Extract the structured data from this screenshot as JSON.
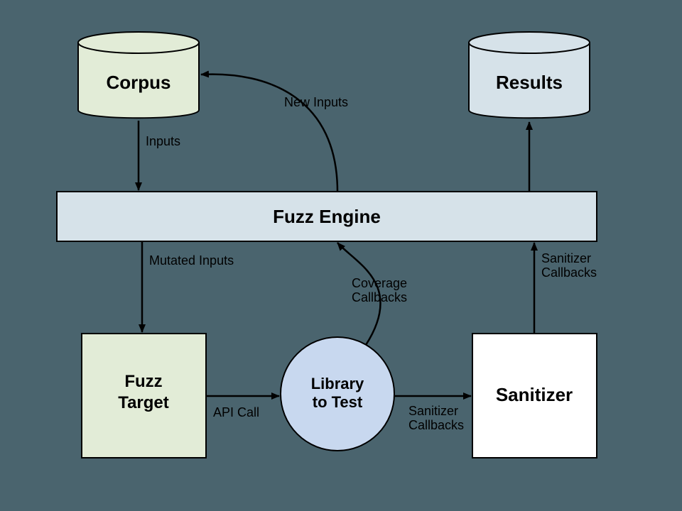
{
  "nodes": {
    "corpus": {
      "label": "Corpus"
    },
    "results": {
      "label": "Results"
    },
    "fuzz_engine": {
      "label": "Fuzz Engine"
    },
    "fuzz_target": {
      "line1": "Fuzz",
      "line2": "Target"
    },
    "library": {
      "line1": "Library",
      "line2": "to Test"
    },
    "sanitizer": {
      "label": "Sanitizer"
    }
  },
  "edges": {
    "inputs": "Inputs",
    "new_inputs": "New Inputs",
    "mutated_inputs": "Mutated Inputs",
    "api_call": "API Call",
    "sanitizer_callbacks_lower": "Sanitizer",
    "sanitizer_callbacks_lower2": "Callbacks",
    "sanitizer_callbacks_right": "Sanitizer",
    "sanitizer_callbacks_right2": "Callbacks",
    "coverage_callbacks": "Coverage",
    "coverage_callbacks2": "Callbacks"
  },
  "colors": {
    "corpus_fill": "#e2ecd7",
    "results_fill": "#d6e2e9",
    "fuzz_engine_fill": "#d6e2e9",
    "fuzz_target_fill": "#e2ecd7",
    "library_fill": "#c8d8ef",
    "sanitizer_fill": "#ffffff",
    "stroke": "#000000"
  }
}
